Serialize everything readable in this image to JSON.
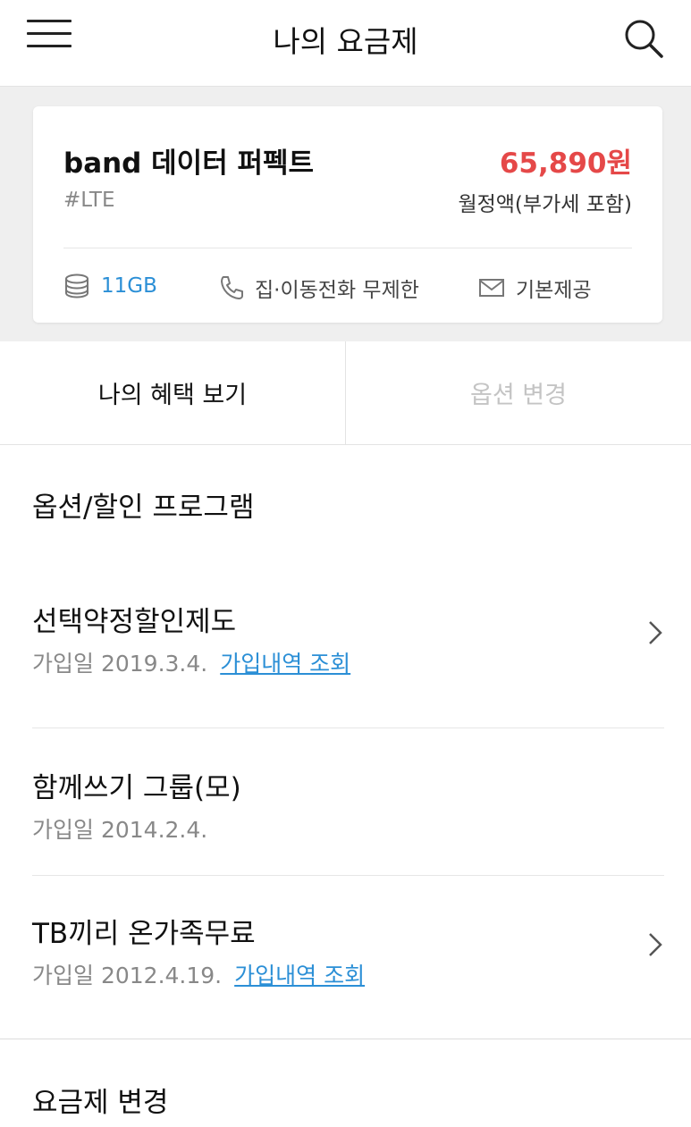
{
  "header": {
    "title": "나의 요금제",
    "menu_icon": "hamburger-menu-icon",
    "search_icon": "search-icon"
  },
  "plan": {
    "name": "band 데이터 퍼펙트",
    "tag": "#LTE",
    "price": "65,890원",
    "price_note": "월정액(부가세 포함)",
    "price_color": "#e54848",
    "features": {
      "data": "11GB",
      "call": "집·이동전화 무제한",
      "message": "기본제공"
    },
    "accent_color": "#2b8fd6"
  },
  "tabs": {
    "benefit": "나의 혜택 보기",
    "option_change": "옵션 변경"
  },
  "section": {
    "title": "옵션/할인 프로그램"
  },
  "items": [
    {
      "title": "선택약정할인제도",
      "date": "가입일 2019.3.4.",
      "link": "가입내역 조회"
    },
    {
      "title": "함께쓰기 그룹(모)",
      "date": "가입일 2014.2.4."
    },
    {
      "title": "TB끼리 온가족무료",
      "date": "가입일 2012.4.19.",
      "link": "가입내역 조회"
    }
  ],
  "footer": {
    "plan_change": "요금제 변경"
  }
}
